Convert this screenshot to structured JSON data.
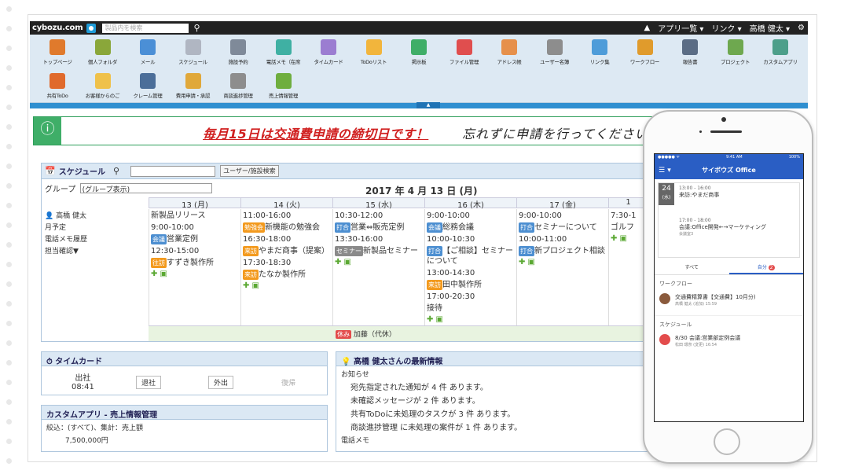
{
  "topbar": {
    "logo": "cybozu.com",
    "search_placeholder": "製品内を検索",
    "apps": "アプリ一覧",
    "links": "リンク",
    "user": "高橋 健太"
  },
  "apps_row1": [
    "トップページ",
    "個人フォルダ",
    "メール",
    "スケジュール",
    "施設予約",
    "電話メモ（在席",
    "タイムカード",
    "ToDoリスト",
    "掲示板",
    "ファイル管理",
    "アドレス帳",
    "ユーザー名簿",
    "リンク集",
    "ワークフロー",
    "報告書",
    "プロジェクト",
    "カスタムアプリ"
  ],
  "apps_row2": [
    "共有ToDo",
    "お客様からのご",
    "クレーム管理",
    "費用申請・承認",
    "商談進捗管理",
    "売上情報管理"
  ],
  "app_colors": [
    "#e07a2c",
    "#8aa73a",
    "#4b8fd6",
    "#b0b6c2",
    "#7f8a99",
    "#3fb0a3",
    "#9b7dd1",
    "#f2b53c",
    "#3fae68",
    "#e04e4e",
    "#e6904b",
    "#8d8d8d",
    "#4e9cd9",
    "#e09b2c",
    "#5b6d85",
    "#6ea84f",
    "#4d9f8a"
  ],
  "app2_colors": [
    "#e06a2c",
    "#efc14a",
    "#4b6e99",
    "#e0a83a",
    "#8d8d8d",
    "#6fae3f"
  ],
  "notice": {
    "strong": "毎月15日は交通費申請の締切日です！",
    "rest": "忘れずに申請を行ってください"
  },
  "schedule": {
    "title": "スケジュール",
    "button": "ユーザー/施設検索",
    "group_label": "グループ",
    "group_value": "(グループ表示)",
    "date": "2017 年 4 月 13 日 (月)",
    "days": [
      "13 (月)",
      "14 (火)",
      "15 (水)",
      "16 (木)",
      "17 (金)",
      "1"
    ],
    "user": "高橋 健太",
    "links": [
      "月予定",
      "電話メモ履歴",
      "担当確認▼"
    ],
    "cols": [
      [
        [
          "",
          "",
          "新製品リリース"
        ],
        [
          "9:00-10:00",
          "",
          ""
        ],
        [
          "",
          "会議",
          "営業定例"
        ],
        [
          "12:30-15:00",
          "",
          ""
        ],
        [
          "",
          "往訪",
          "すずき製作所"
        ]
      ],
      [
        [
          "11:00-16:00",
          "",
          ""
        ],
        [
          "",
          "勉強会",
          "新機能の勉強会"
        ],
        [
          "16:30-18:00",
          "",
          ""
        ],
        [
          "",
          "来訪",
          "やまだ商事（提案）"
        ],
        [
          "17:30-18:30",
          "",
          ""
        ],
        [
          "",
          "来訪",
          "たなか製作所"
        ]
      ],
      [
        [
          "10:30-12:00",
          "",
          ""
        ],
        [
          "",
          "打合",
          "営業⇔販売定例"
        ],
        [
          "13:30-16:00",
          "",
          ""
        ],
        [
          "",
          "セミナー",
          "新製品セミナー"
        ]
      ],
      [
        [
          "9:00-10:00",
          "",
          ""
        ],
        [
          "",
          "会議",
          "総務会議"
        ],
        [
          "10:00-10:30",
          "",
          ""
        ],
        [
          "",
          "打合",
          "【ご相談】セミナーについて"
        ],
        [
          "13:00-14:30",
          "",
          ""
        ],
        [
          "",
          "来訪",
          "田中製作所"
        ],
        [
          "17:00-20:30",
          "",
          ""
        ],
        [
          "",
          "",
          "接待"
        ]
      ],
      [
        [
          "9:00-10:00",
          "",
          ""
        ],
        [
          "",
          "打合",
          "セミナーについて"
        ],
        [
          "10:00-11:00",
          "",
          ""
        ],
        [
          "",
          "打合",
          "新プロジェクト相談"
        ]
      ],
      [
        [
          "7:30-1",
          "",
          ""
        ],
        [
          "",
          "",
          "ゴルフ"
        ]
      ]
    ],
    "bottom": "加藤（代休）",
    "bottom_tag": "休み"
  },
  "timecard": {
    "title": "タイムカード",
    "label": "出社",
    "time": "08:41",
    "b1": "退社",
    "b2": "外出",
    "b3": "復帰"
  },
  "customapp": {
    "title": "カスタムアプリ - 売上情報管理",
    "filter": "絞込：(すべて)、集計：売上額",
    "value": "7,500,000円"
  },
  "news": {
    "title": "高橋 健太さんの最新情報",
    "sub": "お知らせ",
    "lines": [
      "宛先指定された通知が 4 件 あります。",
      "未確認メッセージが 2 件 あります。",
      "共有ToDoに未処理のタスクが 3 件 あります。",
      "商談進捗管理 に未処理の案件が 1 件 あります。"
    ],
    "footer": "電話メモ"
  },
  "phone": {
    "time": "9:41 AM",
    "battery": "100%",
    "title": "サイボウズ Office",
    "day": "24",
    "dow": "(水)",
    "e1_time": "13:00 - 16:00",
    "e1": "来訪:やまだ商事",
    "e2_time": "17:00 - 18:00",
    "e2": "会議:Office開発←→マーケティング",
    "e2_sub": "会議室3",
    "tab_all": "すべて",
    "tab_me": "自分",
    "badge": "2",
    "sec1": "ワークフロー",
    "w1": "交通費精算書【交通費】10月分)",
    "w1_sub": "高橋 健太 (追加)  15:59",
    "sec2": "スケジュール",
    "s1": "8/30 会議:営業部定例会議",
    "s1_sub": "松田 環奈 (変更)  16:54",
    "w_color": "#8a5a3c",
    "s_color": "#e34c4c"
  }
}
